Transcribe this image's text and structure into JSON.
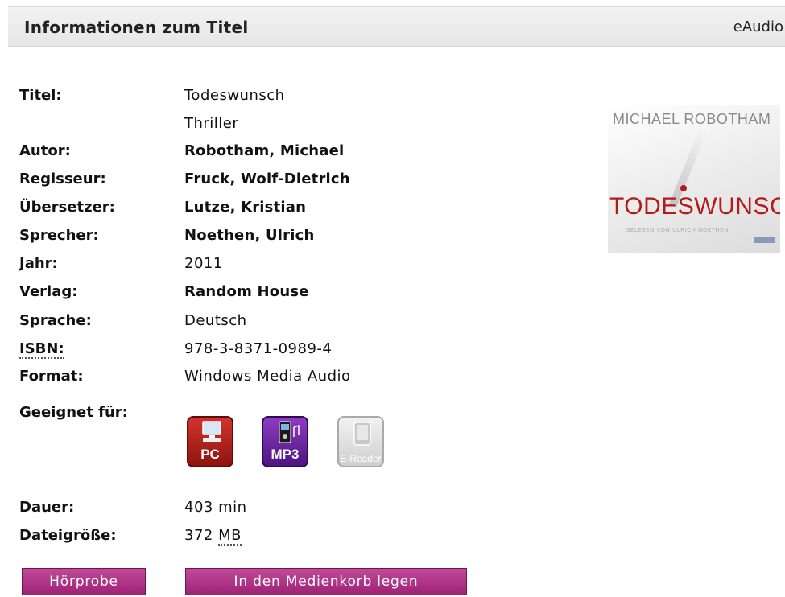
{
  "header": {
    "title": "Informationen zum Titel",
    "media_type": "eAudio"
  },
  "details": {
    "titel_label": "Titel:",
    "titel": "Todeswunsch",
    "untertitel": "Thriller",
    "autor_label": "Autor:",
    "autor": "Robotham, Michael",
    "regisseur_label": "Regisseur:",
    "regisseur": "Fruck, Wolf-Dietrich",
    "uebersetzer_label": "Übersetzer:",
    "uebersetzer": "Lutze, Kristian",
    "sprecher_label": "Sprecher:",
    "sprecher": "Noethen, Ulrich",
    "jahr_label": "Jahr:",
    "jahr": "2011",
    "verlag_label": "Verlag:",
    "verlag": "Random House",
    "sprache_label": "Sprache:",
    "sprache": "Deutsch",
    "isbn_label": "ISBN:",
    "isbn": "978-3-8371-0989-4",
    "format_label": "Format:",
    "format": "Windows Media Audio",
    "geeignet_label": "Geeignet für:",
    "dauer_label": "Dauer:",
    "dauer": "403 min",
    "dateigroesse_label": "Dateigröße:",
    "dateigroesse_value": "372",
    "dateigroesse_unit": "MB"
  },
  "devices": [
    {
      "caption": "PC",
      "icon": "pc-icon",
      "color": "#b5231c"
    },
    {
      "caption": "MP3",
      "icon": "mp3-player-icon",
      "color": "#6a22a2"
    },
    {
      "caption": "E-Reader",
      "icon": "ereader-icon",
      "color": "#d9d9d9"
    }
  ],
  "cover": {
    "author": "MICHAEL ROBOTHAM",
    "title": "TODESWUNSCH",
    "subtitle": "GELESEN VON ULRICH NOETHEN"
  },
  "buttons": {
    "hoerprobe": "Hörprobe",
    "medienkorb": "In den Medienkorb legen"
  },
  "colors": {
    "button": "#b03a8a",
    "header_bg": "#ececec"
  }
}
